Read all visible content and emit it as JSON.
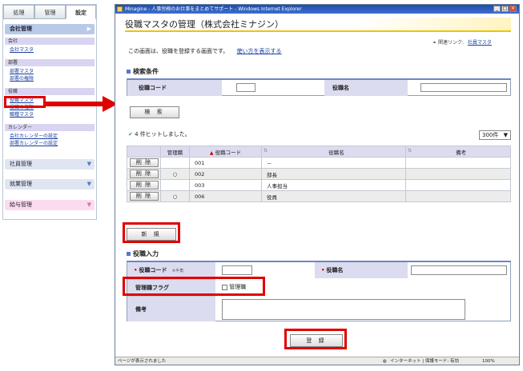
{
  "sidebar": {
    "tabs": [
      "処理",
      "管理",
      "設定"
    ],
    "active_section": "会社管理",
    "categories": [
      {
        "label": "会社",
        "links": [
          "会社マスタ"
        ]
      },
      {
        "label": "部署",
        "links": [
          "部署マスタ",
          "部署の権限"
        ]
      },
      {
        "label": "役職",
        "links": [
          "役職マスタ",
          "役職の権限",
          "職種マスタ"
        ]
      },
      {
        "label": "カレンダー",
        "links": [
          "会社カレンダーの設定",
          "部署カレンダーの設定"
        ]
      }
    ],
    "sections": [
      "社員管理",
      "就業管理",
      "給与管理"
    ]
  },
  "window": {
    "title": "Minagine - 人事労務のお仕事をまとめてサポート - Windows Internet Explorer",
    "heading": "役職マスタの管理（株式会社ミナジン）",
    "related_label": "関連リンク:",
    "related_link": "社員マスタ",
    "description": "この画面は、役職を登録する画面です。",
    "howto_link": "使い方を表示する"
  },
  "search": {
    "title": "検索条件",
    "code_label": "役職コード",
    "name_label": "役職名",
    "code_value": "",
    "name_value": "",
    "button": "検 索"
  },
  "results": {
    "hit_text": "4 件ヒットしました。",
    "page_size": "300件",
    "columns": [
      "管理職",
      "役職コード",
      "役職名",
      "備考"
    ],
    "rows": [
      {
        "delete": "削 除",
        "manager": "",
        "code": "001",
        "name": "－",
        "note": ""
      },
      {
        "delete": "削 除",
        "manager": "○",
        "code": "002",
        "name": "部長",
        "note": ""
      },
      {
        "delete": "削 除",
        "manager": "",
        "code": "003",
        "name": "人事担当",
        "note": ""
      },
      {
        "delete": "削 除",
        "manager": "○",
        "code": "006",
        "name": "役員",
        "note": ""
      }
    ],
    "new_button": "新 規"
  },
  "entry": {
    "title": "役職入力",
    "code_label": "役職コード",
    "code_note": "※半角",
    "name_label": "役職名",
    "flag_label": "管理職フラグ",
    "flag_checkbox_label": "管理職",
    "note_label": "備考",
    "register_button": "登 録"
  },
  "statusbar": {
    "left": "ページが表示されました",
    "zone": "インターネット | 保護モード: 有効",
    "zoom": "100%"
  },
  "colors": {
    "highlight": "#e00000",
    "title_bar": "#1f4ea8",
    "header_accent": "#f0c400"
  }
}
